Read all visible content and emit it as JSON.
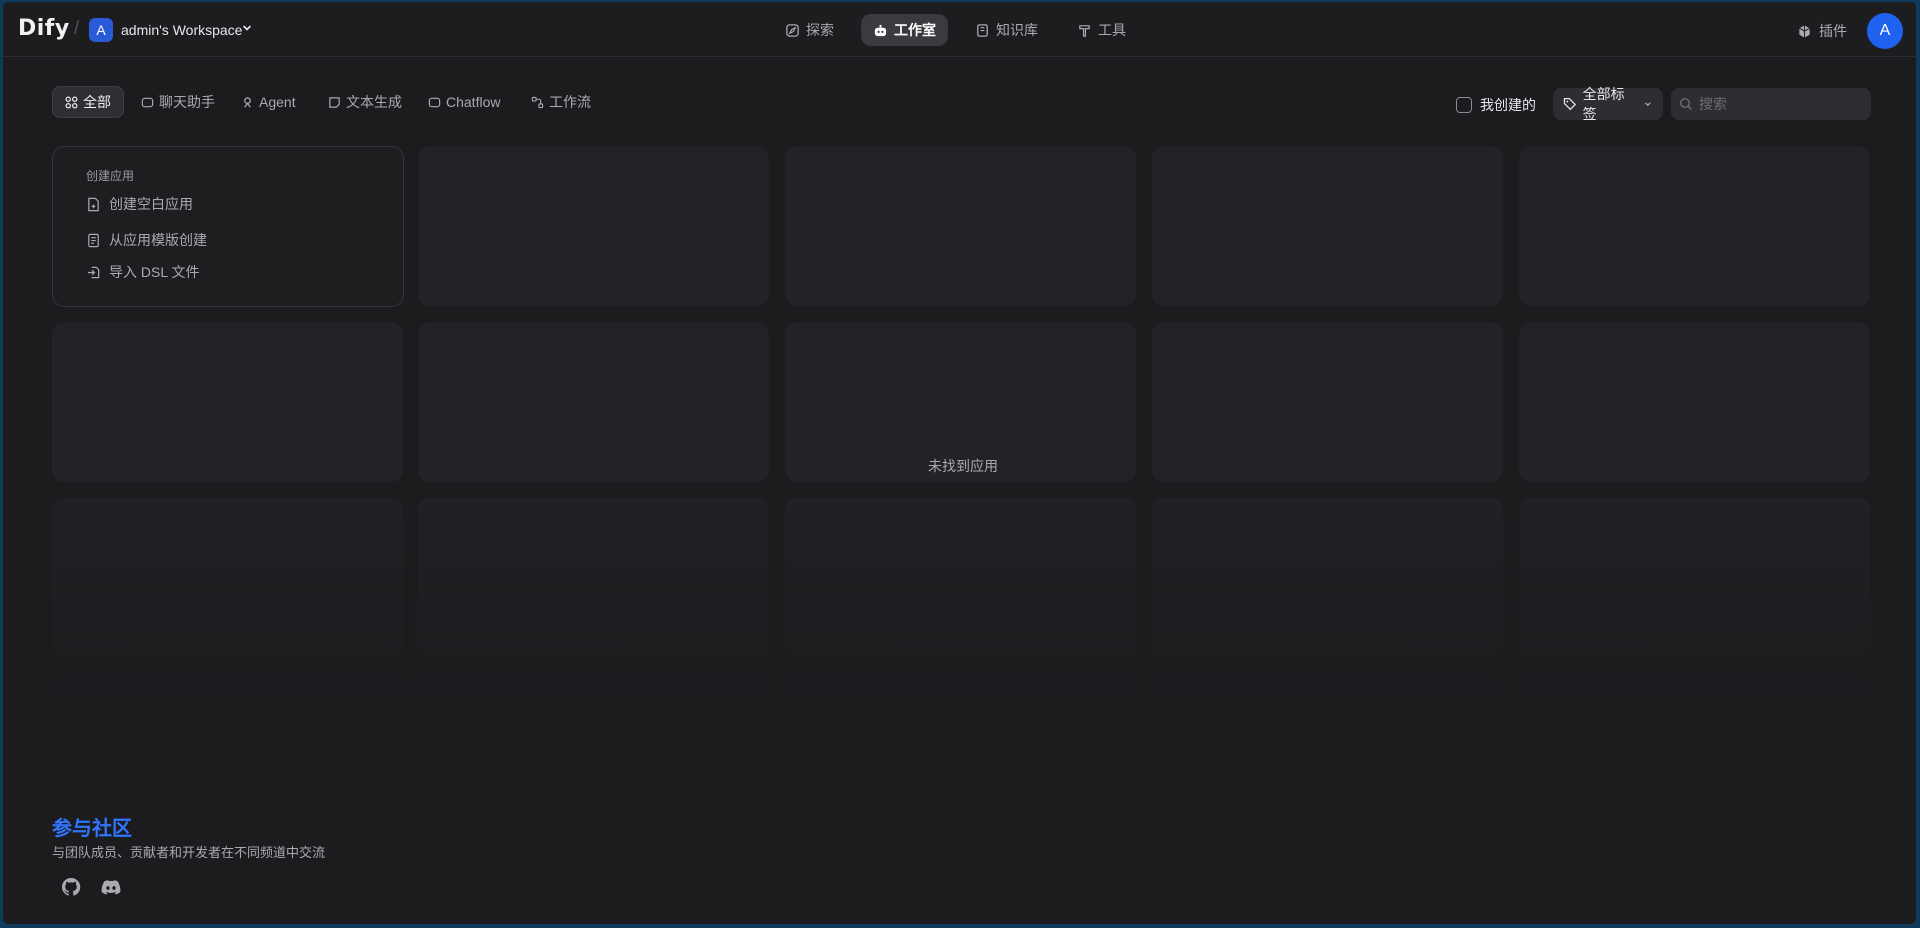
{
  "header": {
    "logo": "Dify",
    "workspace": {
      "avatar": "A",
      "name": "admin's Workspace"
    },
    "nav": [
      {
        "label": "探索",
        "icon": "compass-icon"
      },
      {
        "label": "工作室",
        "icon": "robot-icon",
        "active": true
      },
      {
        "label": "知识库",
        "icon": "book-icon"
      },
      {
        "label": "工具",
        "icon": "hammer-icon"
      }
    ],
    "plugins_label": "插件",
    "user_avatar": "A"
  },
  "filters": {
    "tabs": [
      {
        "label": "全部",
        "active": true
      },
      {
        "label": "聊天助手"
      },
      {
        "label": "Agent"
      },
      {
        "label": "文本生成"
      },
      {
        "label": "Chatflow"
      },
      {
        "label": "工作流"
      }
    ],
    "mine_label": "我创建的",
    "tags_label": "全部标签",
    "search_placeholder": "搜索"
  },
  "create": {
    "title": "创建应用",
    "items": [
      "创建空白应用",
      "从应用模版创建",
      "导入 DSL 文件"
    ]
  },
  "empty_message": "未找到应用",
  "community": {
    "title": "参与社区",
    "subtitle": "与团队成员、贡献者和开发者在不同频道中交流"
  },
  "colors": {
    "accent": "#1f62f0",
    "link": "#2f76ff",
    "background": "#1c1c1f"
  }
}
